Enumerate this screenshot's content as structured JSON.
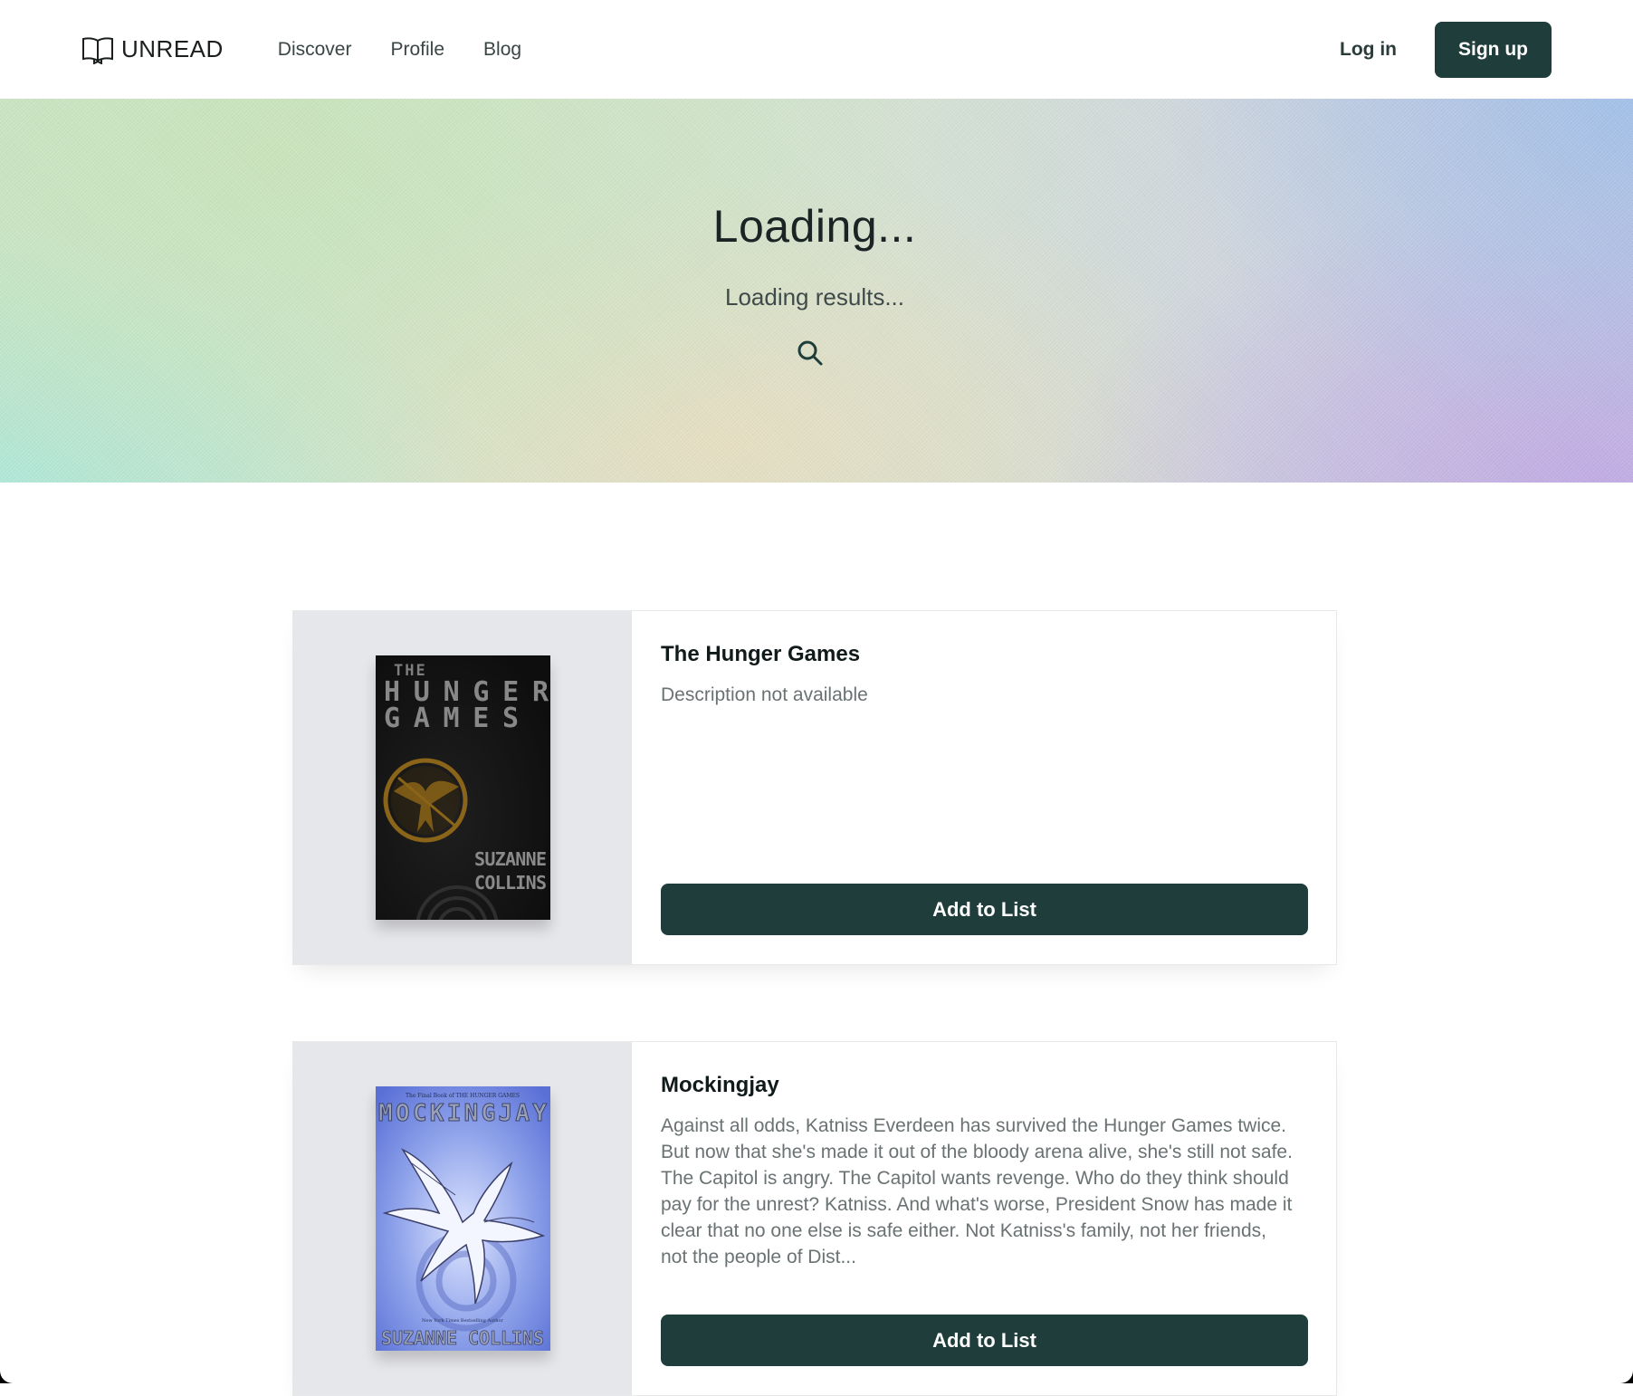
{
  "header": {
    "logo_text": "UNREAD",
    "nav": [
      "Discover",
      "Profile",
      "Blog"
    ],
    "login_label": "Log in",
    "signup_label": "Sign up"
  },
  "hero": {
    "title": "Loading...",
    "subtitle": "Loading results...",
    "search_icon": "search-icon"
  },
  "results": [
    {
      "title": "The Hunger Games",
      "description": "Description not available",
      "button_label": "Add to List",
      "cover": {
        "line1": "THE",
        "line2": "HUNGER",
        "line3": "GAMES",
        "author1": "SUZANNE",
        "author2": "COLLINS"
      }
    },
    {
      "title": "Mockingjay",
      "description": "Against all odds, Katniss Everdeen has survived the Hunger Games twice. But now that she's made it out of the bloody arena alive, she's still not safe. The Capitol is angry. The Capitol wants revenge. Who do they think should pay for the unrest? Katniss. And what's worse, President Snow has made it clear that no one else is safe either. Not Katniss's family, not her friends, not the people of Dist...",
      "button_label": "Add to List",
      "cover": {
        "tagline": "The Final Book of THE HUNGER GAMES",
        "title": "MOCKINGJAY",
        "author_tag": "New York Times Bestselling Author",
        "author": "SUZANNE COLLINS"
      }
    }
  ],
  "colors": {
    "primary": "#1f3d3a",
    "text_muted": "#6a7273",
    "cover_panel_bg": "#e6e7eb"
  }
}
